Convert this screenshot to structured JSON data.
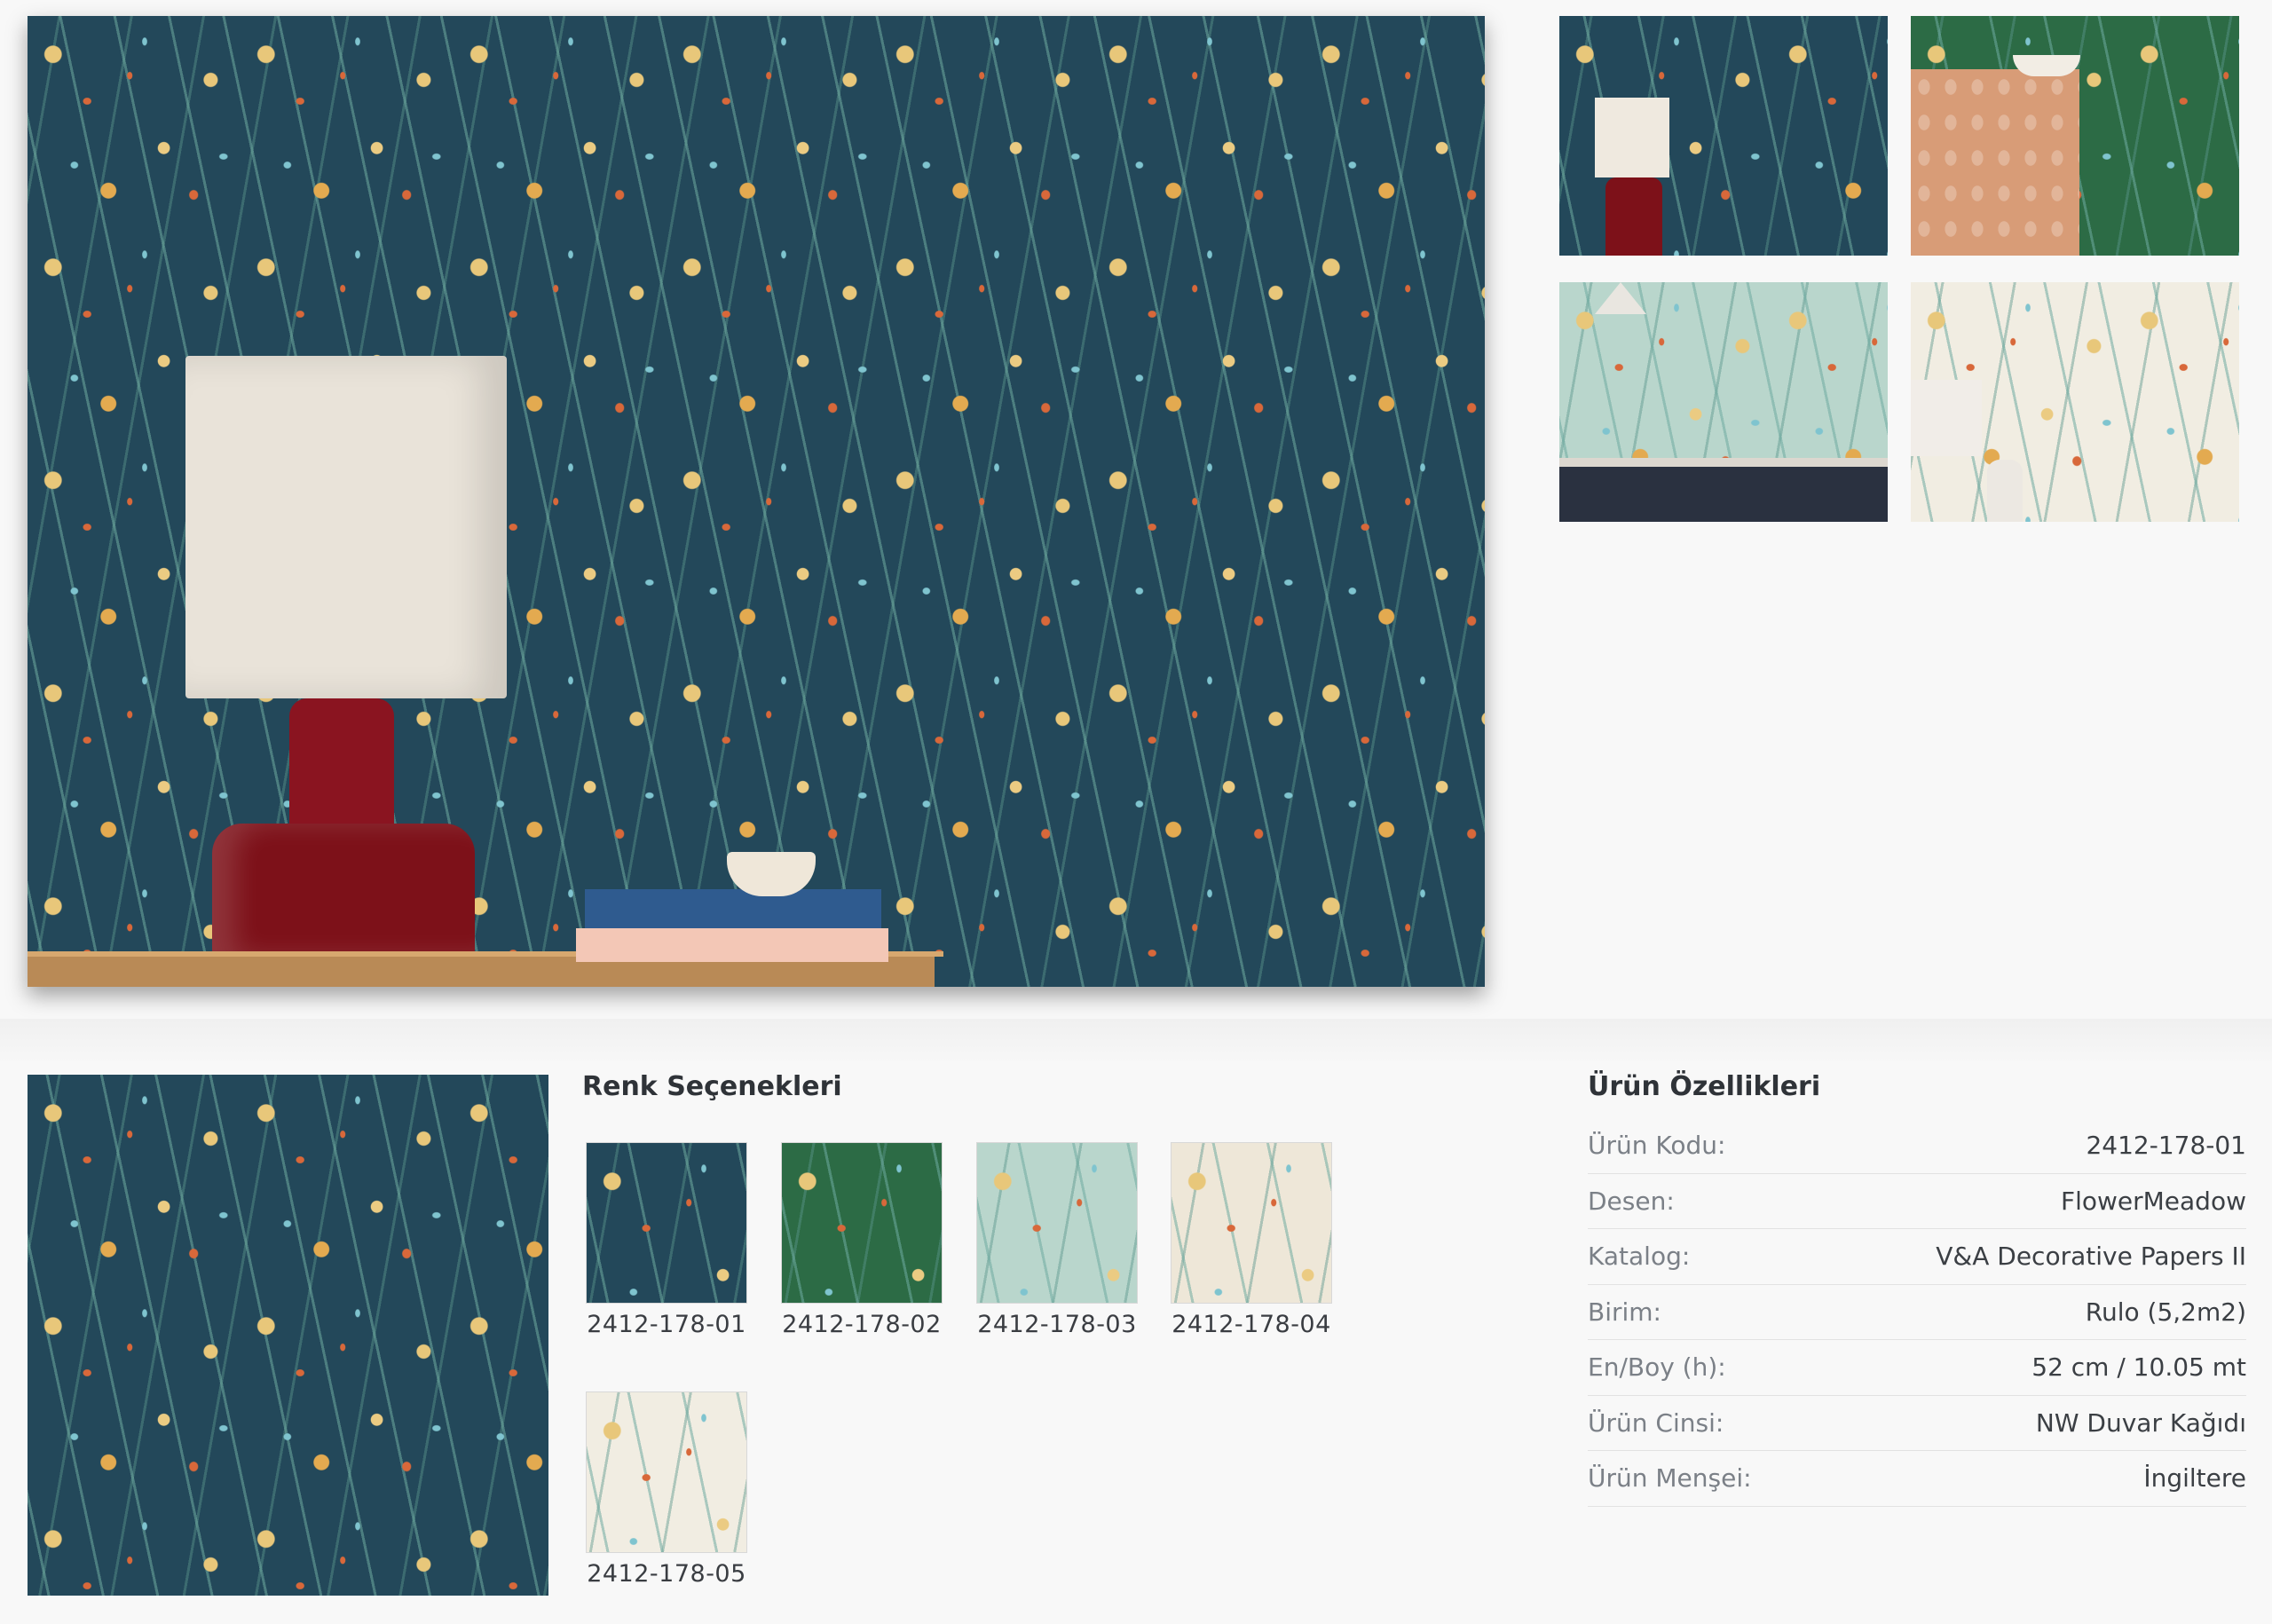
{
  "gallery": {
    "main_image": "wallpaper-room-lamp",
    "thumbnails": [
      "room-lamp-navy",
      "cabinet-green",
      "kitchen-mint",
      "room-lamp-white"
    ]
  },
  "color_options": {
    "title": "Renk Seçenekleri",
    "items": [
      {
        "code": "2412-178-01",
        "color": "#23485a"
      },
      {
        "code": "2412-178-02",
        "color": "#2c6b45"
      },
      {
        "code": "2412-178-03",
        "color": "#b9d6cc"
      },
      {
        "code": "2412-178-04",
        "color": "#eee7d8"
      },
      {
        "code": "2412-178-05",
        "color": "#f1ede2"
      }
    ]
  },
  "properties": {
    "title": "Ürün Özellikleri",
    "rows": [
      {
        "label": "Ürün Kodu:",
        "value": "2412-178-01"
      },
      {
        "label": "Desen:",
        "value": "FlowerMeadow"
      },
      {
        "label": "Katalog:",
        "value": "V&A Decorative Papers II"
      },
      {
        "label": "Birim:",
        "value": "Rulo (5,2m2)"
      },
      {
        "label": "En/Boy (h):",
        "value": "52 cm / 10.05 mt"
      },
      {
        "label": "Ürün Cinsi:",
        "value": "NW Duvar Kağıdı"
      },
      {
        "label": "Ürün Menşei:",
        "value": "İngiltere"
      }
    ]
  }
}
